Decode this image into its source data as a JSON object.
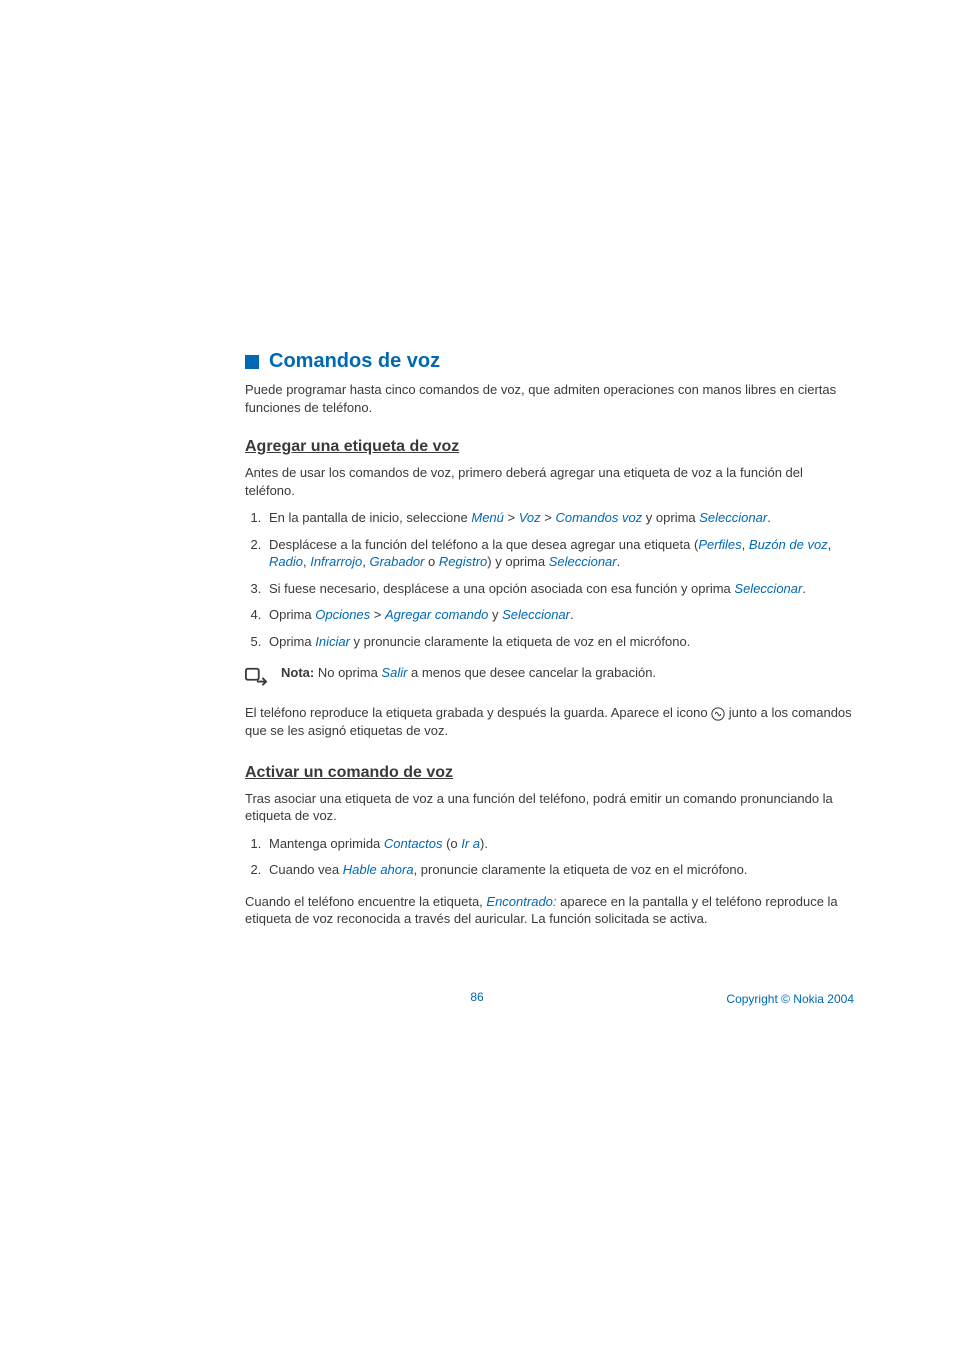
{
  "section": {
    "title": "Comandos de voz",
    "intro": "Puede programar hasta cinco comandos de voz, que admiten operaciones con manos libres en ciertas funciones de teléfono."
  },
  "sub1": {
    "title": "Agregar una etiqueta de voz",
    "intro": "Antes de usar los comandos de voz, primero deberá agregar una etiqueta de voz a la función del teléfono.",
    "s1": {
      "pre": "En la pantalla de inicio, seleccione ",
      "menu": "Menú",
      "gt1": " > ",
      "voz": "Voz",
      "gt2": " > ",
      "cmd": "Comandos voz",
      "post1": " y oprima ",
      "sel": "Seleccionar",
      "dot": "."
    },
    "s2": {
      "pre": "Desplácese a la función del teléfono a la que desea agregar una etiqueta (",
      "perf": "Perfiles",
      "c1": ", ",
      "buz": "Buzón de voz",
      "c2": ", ",
      "rad": "Radio",
      "c3": ", ",
      "inf": "Infrarrojo",
      "c4": ", ",
      "gra": "Grabador",
      "o": " o ",
      "reg": "Registro",
      "post1": ") y oprima ",
      "sel": "Seleccionar",
      "dot": "."
    },
    "s3": {
      "pre": "Si fuese necesario, desplácese a una opción asociada con esa función y oprima ",
      "sel": "Seleccionar",
      "dot": "."
    },
    "s4": {
      "pre": "Oprima ",
      "opc": "Opciones",
      "gt": " > ",
      "agr": "Agregar comando",
      "y": " y ",
      "sel": "Seleccionar",
      "dot": "."
    },
    "s5": {
      "pre": "Oprima ",
      "ini": "Iniciar",
      "post": " y pronuncie claramente la etiqueta de voz en el micrófono."
    },
    "note": {
      "bold": "Nota: ",
      "pre": "No oprima ",
      "salir": "Salir",
      "post": " a menos que desee cancelar la grabación."
    },
    "followup": {
      "p1": "El teléfono reproduce la etiqueta grabada y después la guarda. Aparece el icono ",
      "p2": " junto a los comandos que se les asignó etiquetas de voz."
    }
  },
  "sub2": {
    "title": "Activar un comando de voz",
    "intro": "Tras asociar una etiqueta de voz a una función del teléfono, podrá emitir un comando pronunciando la etiqueta de voz.",
    "s1": {
      "pre": "Mantenga oprimida ",
      "con": "Contactos",
      "o1": " (o ",
      "ira": "Ir a",
      "o2": ")."
    },
    "s2": {
      "pre": "Cuando vea ",
      "hab": "Hable ahora",
      "post": ", pronuncie claramente la etiqueta de voz en el micrófono."
    },
    "followup": {
      "p1": "Cuando el teléfono encuentre la etiqueta, ",
      "enc": "Encontrado:",
      "p2": " aparece en la pantalla y el teléfono reproduce la etiqueta de voz reconocida a través del auricular. La función solicitada se activa."
    }
  },
  "footer": {
    "pagenum": "86",
    "copyright": "Copyright © Nokia 2004"
  }
}
